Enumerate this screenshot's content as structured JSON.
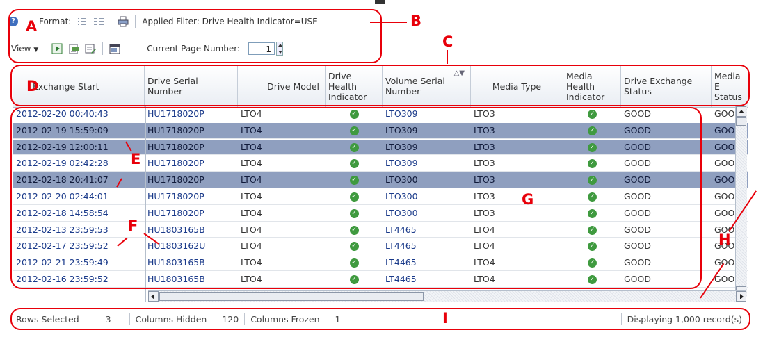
{
  "toolbar": {
    "format_label": "Format:",
    "applied_filter": "Applied Filter: Drive Health Indicator=USE",
    "view_label": "View",
    "page_label": "Current Page Number:",
    "page_value": "1"
  },
  "columns": [
    "Exchange Start",
    "Drive Serial Number",
    "Drive Model",
    "Drive Health Indicator",
    "Volume Serial Number",
    "Media Type",
    "Media Health Indicator",
    "Drive Exchange Status",
    "Media E Status"
  ],
  "rows": [
    {
      "start": "2012-02-20 00:40:43",
      "serial": "HU1718020P",
      "model": "LTO4",
      "volume": "LTO309",
      "media": "LTO3",
      "status": "GOOD",
      "mstatus": "GOOD",
      "selected": false
    },
    {
      "start": "2012-02-19 15:59:09",
      "serial": "HU1718020P",
      "model": "LTO4",
      "volume": "LTO309",
      "media": "LTO3",
      "status": "GOOD",
      "mstatus": "GOOD",
      "selected": true
    },
    {
      "start": "2012-02-19 12:00:11",
      "serial": "HU1718020P",
      "model": "LTO4",
      "volume": "LTO309",
      "media": "LTO3",
      "status": "GOOD",
      "mstatus": "GOOD",
      "selected": true
    },
    {
      "start": "2012-02-19 02:42:28",
      "serial": "HU1718020P",
      "model": "LTO4",
      "volume": "LTO309",
      "media": "LTO3",
      "status": "GOOD",
      "mstatus": "GOOD",
      "selected": false
    },
    {
      "start": "2012-02-18 20:41:07",
      "serial": "HU1718020P",
      "model": "LTO4",
      "volume": "LTO300",
      "media": "LTO3",
      "status": "GOOD",
      "mstatus": "GOOD",
      "selected": true
    },
    {
      "start": "2012-02-20 02:44:01",
      "serial": "HU1718020P",
      "model": "LTO4",
      "volume": "LTO300",
      "media": "LTO3",
      "status": "GOOD",
      "mstatus": "GOOD",
      "selected": false
    },
    {
      "start": "2012-02-18 14:58:54",
      "serial": "HU1718020P",
      "model": "LTO4",
      "volume": "LTO300",
      "media": "LTO3",
      "status": "GOOD",
      "mstatus": "GOOD",
      "selected": false
    },
    {
      "start": "2012-02-13 23:59:53",
      "serial": "HU1803165B",
      "model": "LTO4",
      "volume": "LT4465",
      "media": "LTO4",
      "status": "GOOD",
      "mstatus": "GOOD",
      "selected": false
    },
    {
      "start": "2012-02-17 23:59:52",
      "serial": "HU1803162U",
      "model": "LTO4",
      "volume": "LT4465",
      "media": "LTO4",
      "status": "GOOD",
      "mstatus": "GOOD",
      "selected": false
    },
    {
      "start": "2012-02-21 23:59:49",
      "serial": "HU1803165B",
      "model": "LTO4",
      "volume": "LT4465",
      "media": "LTO4",
      "status": "GOOD",
      "mstatus": "GOOD",
      "selected": false
    },
    {
      "start": "2012-02-16 23:59:52",
      "serial": "HU1803165B",
      "model": "LTO4",
      "volume": "LT4465",
      "media": "LTO4",
      "status": "GOOD",
      "mstatus": "GOOD",
      "selected": false
    }
  ],
  "status": {
    "rows_selected_label": "Rows Selected",
    "rows_selected": "3",
    "columns_hidden_label": "Columns Hidden",
    "columns_hidden": "120",
    "columns_frozen_label": "Columns Frozen",
    "columns_frozen": "1",
    "displaying": "Displaying 1,000 record(s)"
  },
  "annotations": [
    "A",
    "B",
    "C",
    "D",
    "E",
    "F",
    "G",
    "H",
    "I"
  ],
  "colors": {
    "annotation": "#e8000a",
    "selected_row": "#8f9fbf",
    "link": "#1a3a8a",
    "check": "#3f9a3f"
  }
}
